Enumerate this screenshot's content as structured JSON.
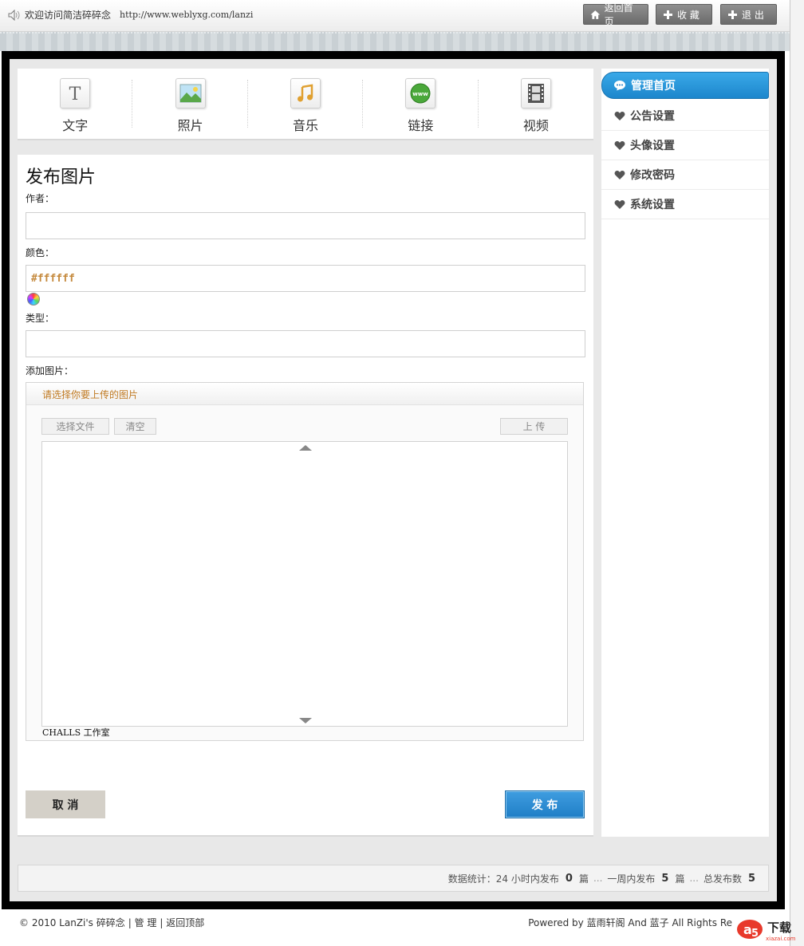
{
  "header": {
    "welcome": "欢迎访问简洁碎碎念",
    "url": "http://www.weblyxg.com/lanzi",
    "home_btn": "返回首页",
    "fav_btn": "收 藏",
    "logout_btn": "退 出"
  },
  "types": [
    {
      "label": "文字",
      "icon": "text-icon"
    },
    {
      "label": "照片",
      "icon": "photo-icon"
    },
    {
      "label": "音乐",
      "icon": "music-icon"
    },
    {
      "label": "链接",
      "icon": "link-www-icon"
    },
    {
      "label": "视频",
      "icon": "film-icon"
    }
  ],
  "form": {
    "title": "发布图片",
    "author_label": "作者：",
    "author_value": "",
    "color_label": "颜色：",
    "color_value": "#ffffff",
    "type_label": "类型：",
    "type_value": "",
    "add_image_label": "添加图片：",
    "uploader_title": "请选择你要上传的图片",
    "select_file": "选择文件",
    "clear": "清空",
    "upload": "上 传",
    "uploader_footer": "CHALLS 工作室",
    "cancel": "取 消",
    "publish": "发 布"
  },
  "sidebar": {
    "active": "管理首页",
    "items": [
      "公告设置",
      "头像设置",
      "修改密码",
      "系统设置"
    ]
  },
  "stats": {
    "prefix": "数据统计：24 小时内发布",
    "day_count": "0",
    "unit1": "篇",
    "week_label": "一周内发布",
    "week_count": "5",
    "unit2": "篇",
    "total_label": "总发布数",
    "total_count": "5",
    "dots": "..."
  },
  "footer": {
    "copyright": "© 2010 LanZi's 碎碎念",
    "admin": "| 管 理",
    "back_top": "| 返回顶部",
    "powered": "Powered by 蓝雨轩阁 And 蓝子 All Rights Re",
    "logo_text": "下载",
    "logo_sub": "xiazai.com"
  },
  "colors": {
    "accent_blue": "#1f7ec6",
    "color_value_text": "#c58a3e",
    "uploader_title_text": "#c07a22"
  }
}
